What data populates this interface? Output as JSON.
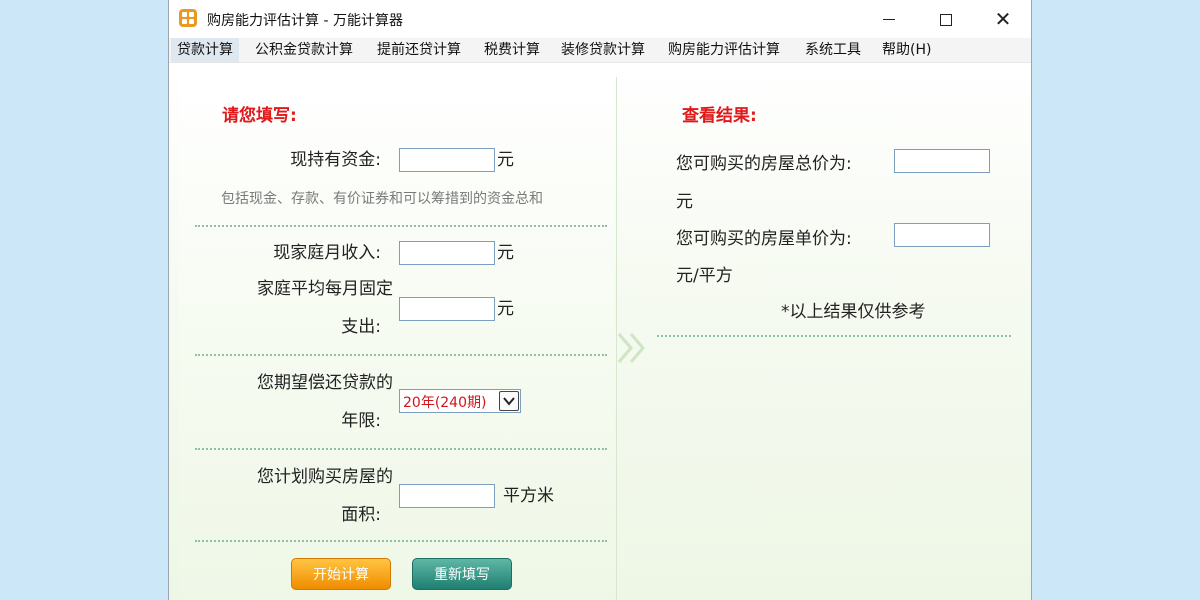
{
  "window": {
    "title": "购房能力评估计算 - 万能计算器"
  },
  "menu": [
    "贷款计算",
    "公积金贷款计算",
    "提前还贷计算",
    "税费计算",
    "装修贷款计算",
    "购房能力评估计算",
    "系统工具",
    "帮助(H)"
  ],
  "left": {
    "heading": "请您填写:",
    "funds": {
      "label": "现持有资金:",
      "unit": "元",
      "hint": "包括现金、存款、有价证券和可以筹措到的资金总和",
      "value": ""
    },
    "income": {
      "label": "现家庭月收入:",
      "unit": "元",
      "value": ""
    },
    "expense": {
      "label_line1": "家庭平均每月固定",
      "label_line2": "支出:",
      "unit": "元",
      "value": ""
    },
    "term": {
      "label_line1": "您期望偿还贷款的",
      "label_line2": "年限:",
      "selected": "20年(240期)"
    },
    "area": {
      "label_line1": "您计划购买房屋的",
      "label_line2": "面积:",
      "unit": "平方米",
      "value": ""
    },
    "buttons": {
      "start": "开始计算",
      "reset": "重新填写"
    }
  },
  "right": {
    "heading": "查看结果:",
    "total_price": {
      "label": "您可购买的房屋总价为:",
      "unit": "元",
      "value": ""
    },
    "unit_price": {
      "label": "您可购买的房屋单价为:",
      "unit": "元/平方",
      "value": ""
    },
    "note": "*以上结果仅供参考"
  }
}
